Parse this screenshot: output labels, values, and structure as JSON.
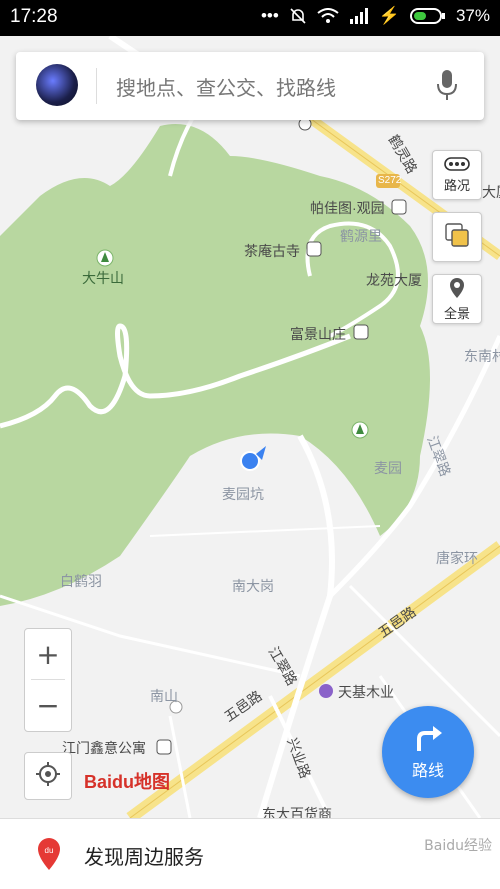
{
  "status_bar": {
    "time": "17:28",
    "battery": "37%"
  },
  "search": {
    "placeholder": "搜地点、查公交、找路线"
  },
  "side_buttons": {
    "traffic": "路况",
    "panorama": "全景"
  },
  "route_button": {
    "label": "路线"
  },
  "logo": {
    "text": "Baidu地图"
  },
  "bottom_bar": {
    "label": "发现周边服务",
    "watermark": "Baidu经验"
  },
  "map": {
    "labels": {
      "pajiatu": "帕佳图·观园",
      "chaan": "茶庵古寺",
      "heyuanli": "鹤源里",
      "longyuan": "龙苑大厦",
      "daniushan": "大牛山",
      "fujing": "富景山庄",
      "dongnan": "东南村",
      "maiyuan": "麦园",
      "maiyuankeng": "麦园坑",
      "jiangcui": "江翠路",
      "tangjiahuan": "唐家环",
      "baiheyu": "白鹤羽",
      "nandagang": "南大岗",
      "wuyilu1": "五邑路",
      "wuyilu2": "五邑路",
      "jiangcuilu2": "江翠路",
      "tianjimu": "天基木业",
      "nanshan": "南山",
      "jiangmen": "江门鑫意公寓",
      "xingye": "兴业路",
      "dongda": "东大百货商",
      "heling": "鹤灵路",
      "s272": "S272",
      "da": "大厦"
    }
  }
}
